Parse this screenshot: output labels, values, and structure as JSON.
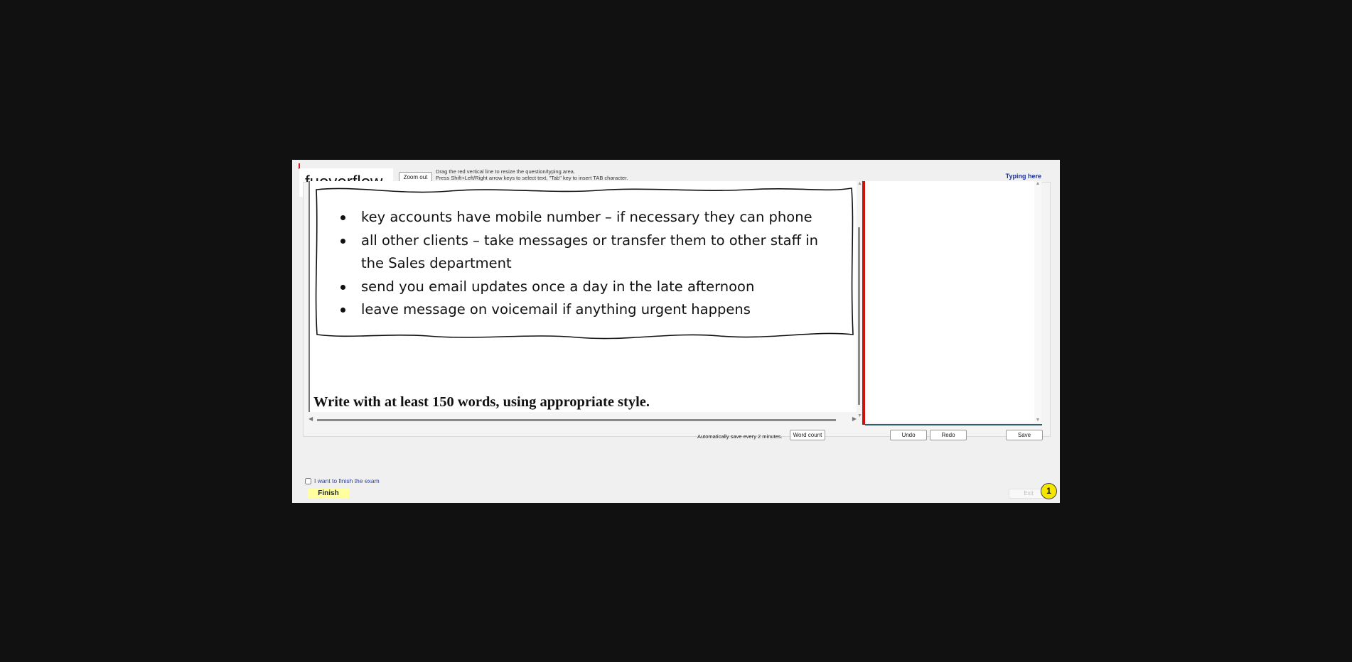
{
  "header": {
    "logo_text": "fuoverflow",
    "zoom_out_label": "Zoom out",
    "instruction_line1": "Drag the red vertical line to resize the question/typing area.",
    "instruction_line2": "Press Shift+Left/Right arrow keys to select text, \"Tab\" key to insert TAB character.",
    "typing_here_label": "Typing here"
  },
  "question": {
    "bullets": [
      "key accounts have mobile number – if necessary they can phone",
      "all other clients – take messages or transfer them to other staff in the Sales department",
      "send you email updates once a day in the late afternoon",
      "leave message on voicemail if anything urgent happens"
    ],
    "prompt": "Write with at least 150 words, using appropriate style."
  },
  "typing": {
    "value": ""
  },
  "toolbar": {
    "autosave_text": "Automatically save every 2 minutes.",
    "word_count_label": "Word count",
    "undo_label": "Undo",
    "redo_label": "Redo",
    "save_label": "Save"
  },
  "footer": {
    "finish_checkbox_label": "I want to finish the exam",
    "finish_label": "Finish",
    "exit_label": "Exit",
    "badge_number": "1"
  },
  "colors": {
    "splitter": "#d01010",
    "finish_button": "#ffff9e",
    "badge": "#f5e600",
    "typing_label": "#1a2fa0"
  }
}
